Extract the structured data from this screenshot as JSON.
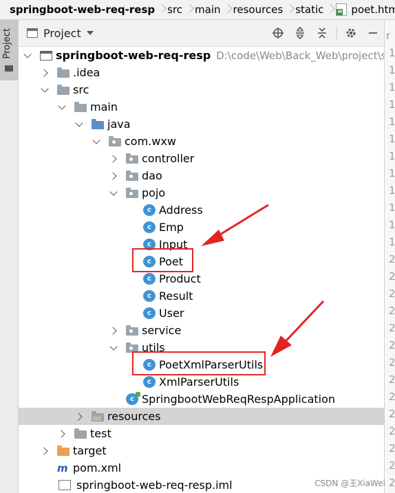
{
  "breadcrumb": [
    "springboot-web-req-resp",
    "src",
    "main",
    "resources",
    "static",
    "poet.html"
  ],
  "tool_window": {
    "tab_label": "Project"
  },
  "panel": {
    "title": "Project",
    "icons": [
      "locate-icon",
      "expand-all-icon",
      "collapse-all-icon",
      "gear-icon",
      "minimize-icon"
    ]
  },
  "gutter_numbers": [
    "r",
    "1",
    "1",
    "1",
    "1",
    "1",
    "1",
    "1",
    "1",
    "1",
    "1",
    "1",
    "1",
    "2",
    "2",
    "2",
    "2",
    "2",
    "2",
    "2",
    "2",
    "2",
    "2",
    "2",
    "2",
    "2",
    "2"
  ],
  "tree": [
    {
      "level": 0,
      "arrow": "down",
      "icon": "module",
      "label": "springboot-web-req-resp",
      "bold": true,
      "hint": "D:\\code\\Web\\Back_Web\\project\\spring"
    },
    {
      "level": 1,
      "arrow": "right",
      "icon": "folder",
      "label": ".idea"
    },
    {
      "level": 1,
      "arrow": "down",
      "icon": "folder",
      "label": "src"
    },
    {
      "level": 2,
      "arrow": "down",
      "icon": "folder",
      "label": "main"
    },
    {
      "level": 3,
      "arrow": "down",
      "icon": "folder-blue",
      "label": "java"
    },
    {
      "level": 4,
      "arrow": "down",
      "icon": "pkg",
      "label": "com.wxw"
    },
    {
      "level": 5,
      "arrow": "right",
      "icon": "pkg",
      "label": "controller"
    },
    {
      "level": 5,
      "arrow": "right",
      "icon": "pkg",
      "label": "dao"
    },
    {
      "level": 5,
      "arrow": "down",
      "icon": "pkg",
      "label": "pojo"
    },
    {
      "level": 6,
      "arrow": "none",
      "icon": "cls",
      "label": "Address"
    },
    {
      "level": 6,
      "arrow": "none",
      "icon": "cls",
      "label": "Emp"
    },
    {
      "level": 6,
      "arrow": "none",
      "icon": "cls",
      "label": "Input"
    },
    {
      "level": 6,
      "arrow": "none",
      "icon": "cls",
      "label": "Poet"
    },
    {
      "level": 6,
      "arrow": "none",
      "icon": "cls",
      "label": "Product"
    },
    {
      "level": 6,
      "arrow": "none",
      "icon": "cls",
      "label": "Result"
    },
    {
      "level": 6,
      "arrow": "none",
      "icon": "cls",
      "label": "User"
    },
    {
      "level": 5,
      "arrow": "right",
      "icon": "pkg",
      "label": "service"
    },
    {
      "level": 5,
      "arrow": "down",
      "icon": "pkg",
      "label": "utils"
    },
    {
      "level": 6,
      "arrow": "none",
      "icon": "cls",
      "label": "PoetXmlParserUtils"
    },
    {
      "level": 6,
      "arrow": "none",
      "icon": "cls",
      "label": "XmlParserUtils"
    },
    {
      "level": 5,
      "arrow": "none",
      "icon": "cls-spring",
      "label": "SpringbootWebReqRespApplication"
    },
    {
      "level": 3,
      "arrow": "right",
      "icon": "res",
      "label": "resources",
      "selected": true
    },
    {
      "level": 2,
      "arrow": "right",
      "icon": "folder",
      "label": "test"
    },
    {
      "level": 1,
      "arrow": "right",
      "icon": "folder-orange",
      "label": "target"
    },
    {
      "level": 1,
      "arrow": "none",
      "icon": "maven",
      "label": "pom.xml"
    },
    {
      "level": 1,
      "arrow": "none",
      "icon": "iml",
      "label": "springboot-web-req-resp.iml"
    }
  ],
  "watermark": "CSDN @王XiaWei",
  "colors": {
    "highlight": "#e32424",
    "selection": "#d4d4d4",
    "class_icon": "#3f93d5"
  }
}
